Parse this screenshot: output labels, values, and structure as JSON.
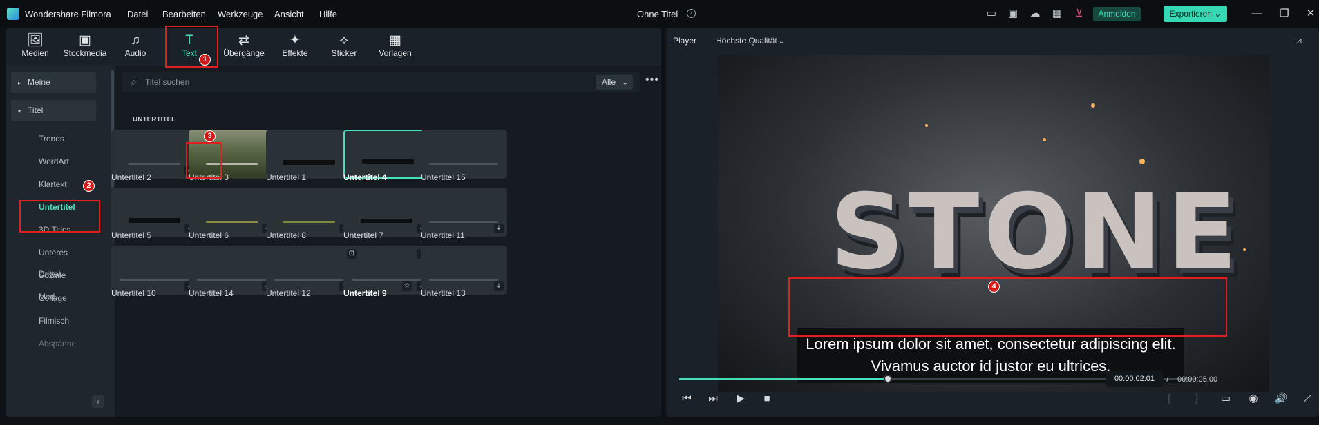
{
  "titlebar": {
    "app_title": "Wondershare Filmora",
    "menu": [
      "Datei",
      "Bearbeiten",
      "Werkzeuge",
      "Ansicht",
      "Hilfe"
    ],
    "doc_title": "Ohne Titel",
    "signin": "Anmelden",
    "export": "Exportieren"
  },
  "toolbar": {
    "tools": [
      {
        "label": "Medien",
        "icon": "media-icon"
      },
      {
        "label": "Stockmedia",
        "icon": "stockmedia-icon"
      },
      {
        "label": "Audio",
        "icon": "audio-icon"
      },
      {
        "label": "Text",
        "icon": "text-icon"
      },
      {
        "label": "Übergänge",
        "icon": "transitions-icon"
      },
      {
        "label": "Effekte",
        "icon": "effects-icon"
      },
      {
        "label": "Sticker",
        "icon": "sticker-icon"
      },
      {
        "label": "Vorlagen",
        "icon": "templates-icon"
      }
    ],
    "active": "Text"
  },
  "sidebar": {
    "parents": [
      "Meine",
      "Titel"
    ],
    "items": [
      "Trends",
      "WordArt",
      "Klartext",
      "Untertitel",
      "3D Titles",
      "Unteres Drittel",
      "Soziale Med...",
      "Collage",
      "Filmisch",
      "Abspänne"
    ],
    "selected": "Untertitel"
  },
  "content": {
    "search_placeholder": "Titel suchen",
    "filter": "Alle",
    "section": "UNTERTITEL",
    "cards": [
      "Untertitel 2",
      "Untertitel 3",
      "Untertitel 1",
      "Untertitel 4",
      "Untertitel 15",
      "Untertitel 5",
      "Untertitel 6",
      "Untertitel 8",
      "Untertitel 7",
      "Untertitel 11",
      "Untertitel 10",
      "Untertitel 14",
      "Untertitel 12",
      "Untertitel 9",
      "Untertitel 13"
    ]
  },
  "annotations": [
    "1",
    "2",
    "3",
    "4"
  ],
  "player": {
    "label": "Player",
    "quality": "Höchste Qualität",
    "preview_title": "STONE",
    "subtitle_line1": "Lorem ipsum dolor sit amet, consectetur adipiscing elit.",
    "subtitle_line2": "Vivamus auctor id justor eu ultrices.",
    "current_time": "00:00:02:01",
    "separator": "/",
    "total_time": "00:00:05:00",
    "progress": 0.404
  },
  "colors": {
    "accent": "#46e0bd",
    "annotation": "#e02020"
  }
}
